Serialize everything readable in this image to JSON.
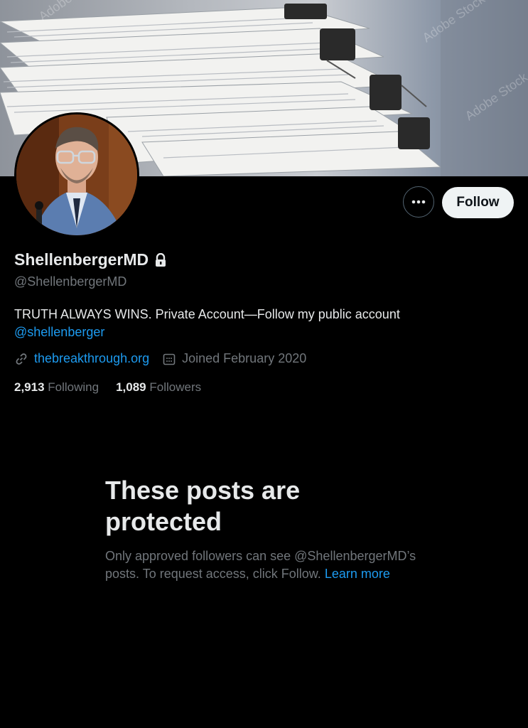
{
  "banner": {
    "image": "stacked-paper-documents-with-binder-clips",
    "watermark": "Adobe Stock"
  },
  "profile": {
    "avatar": "portrait-man-glasses-suit",
    "display_name": "ShellenbergerMD",
    "handle": "@ShellenbergerMD",
    "bio_text": "TRUTH ALWAYS WINS. Private Account—Follow my public account",
    "bio_mention": "@shellenberger",
    "website": "thebreakthrough.org",
    "joined": "Joined February 2020",
    "following_count": "2,913",
    "following_label": "Following",
    "followers_count": "1,089",
    "followers_label": "Followers"
  },
  "actions": {
    "more_label": "•••",
    "follow_label": "Follow"
  },
  "protected": {
    "title": "These posts are protected",
    "description": "Only approved followers can see @ShellenbergerMD’s posts. To request access, click Follow.",
    "learn_more": "Learn more"
  },
  "colors": {
    "background": "#000000",
    "text": "#e7e9ea",
    "muted": "#71767b",
    "accent": "#1d9bf0",
    "button": "#eff3f4"
  }
}
